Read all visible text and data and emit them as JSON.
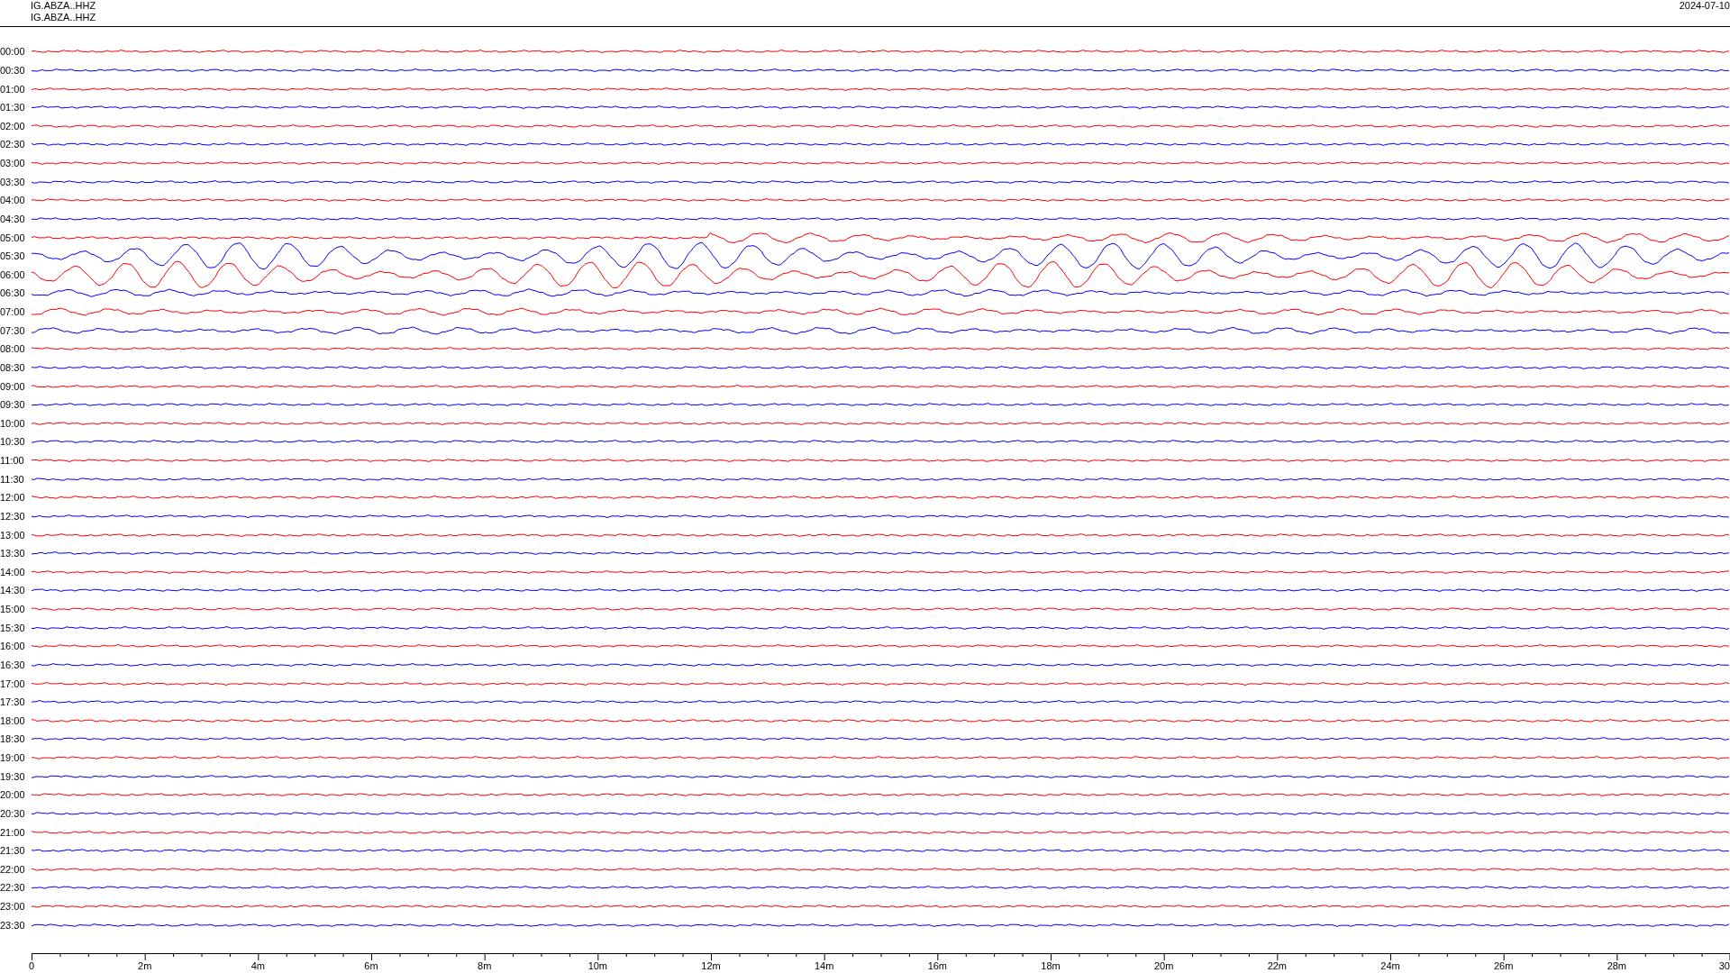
{
  "header": {
    "station_lines": [
      "IG.ABZA..HHZ",
      "IG.ABZA..HHZ"
    ],
    "date": "2024-07-10"
  },
  "traces": [
    {
      "time": "00:00",
      "color": "#ff0000",
      "kind": "noise"
    },
    {
      "time": "00:30",
      "color": "#0000ff",
      "kind": "noise"
    },
    {
      "time": "01:00",
      "color": "#ff0000",
      "kind": "noise"
    },
    {
      "time": "01:30",
      "color": "#0000ff",
      "kind": "noise"
    },
    {
      "time": "02:00",
      "color": "#ff0000",
      "kind": "noise"
    },
    {
      "time": "02:30",
      "color": "#0000ff",
      "kind": "noise"
    },
    {
      "time": "03:00",
      "color": "#ff0000",
      "kind": "noise"
    },
    {
      "time": "03:30",
      "color": "#0000ff",
      "kind": "noise"
    },
    {
      "time": "04:00",
      "color": "#ff0000",
      "kind": "noise"
    },
    {
      "time": "04:30",
      "color": "#0000ff",
      "kind": "noise"
    },
    {
      "time": "05:00",
      "color": "#ff0000",
      "kind": "quake"
    },
    {
      "time": "05:30",
      "color": "#0000ff",
      "kind": "wave"
    },
    {
      "time": "06:00",
      "color": "#ff0000",
      "kind": "wave"
    },
    {
      "time": "06:30",
      "color": "#0000ff",
      "kind": "swell"
    },
    {
      "time": "07:00",
      "color": "#ff0000",
      "kind": "swell"
    },
    {
      "time": "07:30",
      "color": "#0000ff",
      "kind": "swell"
    },
    {
      "time": "08:00",
      "color": "#ff0000",
      "kind": "noise"
    },
    {
      "time": "08:30",
      "color": "#0000ff",
      "kind": "noise"
    },
    {
      "time": "09:00",
      "color": "#ff0000",
      "kind": "noise"
    },
    {
      "time": "09:30",
      "color": "#0000ff",
      "kind": "noise"
    },
    {
      "time": "10:00",
      "color": "#ff0000",
      "kind": "noise"
    },
    {
      "time": "10:30",
      "color": "#0000ff",
      "kind": "noise"
    },
    {
      "time": "11:00",
      "color": "#ff0000",
      "kind": "noise"
    },
    {
      "time": "11:30",
      "color": "#0000ff",
      "kind": "noise"
    },
    {
      "time": "12:00",
      "color": "#ff0000",
      "kind": "noise"
    },
    {
      "time": "12:30",
      "color": "#0000ff",
      "kind": "noise"
    },
    {
      "time": "13:00",
      "color": "#ff0000",
      "kind": "noise"
    },
    {
      "time": "13:30",
      "color": "#0000ff",
      "kind": "noise"
    },
    {
      "time": "14:00",
      "color": "#ff0000",
      "kind": "noise"
    },
    {
      "time": "14:30",
      "color": "#0000ff",
      "kind": "noise"
    },
    {
      "time": "15:00",
      "color": "#ff0000",
      "kind": "noise"
    },
    {
      "time": "15:30",
      "color": "#0000ff",
      "kind": "noise"
    },
    {
      "time": "16:00",
      "color": "#ff0000",
      "kind": "noise"
    },
    {
      "time": "16:30",
      "color": "#0000ff",
      "kind": "noise"
    },
    {
      "time": "17:00",
      "color": "#ff0000",
      "kind": "noise"
    },
    {
      "time": "17:30",
      "color": "#0000ff",
      "kind": "noise"
    },
    {
      "time": "18:00",
      "color": "#ff0000",
      "kind": "noise"
    },
    {
      "time": "18:30",
      "color": "#0000ff",
      "kind": "noise"
    },
    {
      "time": "19:00",
      "color": "#ff0000",
      "kind": "noise"
    },
    {
      "time": "19:30",
      "color": "#0000ff",
      "kind": "noise"
    },
    {
      "time": "20:00",
      "color": "#ff0000",
      "kind": "noise"
    },
    {
      "time": "20:30",
      "color": "#0000ff",
      "kind": "noise"
    },
    {
      "time": "21:00",
      "color": "#ff0000",
      "kind": "noise"
    },
    {
      "time": "21:30",
      "color": "#0000ff",
      "kind": "noise"
    },
    {
      "time": "22:00",
      "color": "#ff0000",
      "kind": "noise"
    },
    {
      "time": "22:30",
      "color": "#0000ff",
      "kind": "noise"
    },
    {
      "time": "23:00",
      "color": "#ff0000",
      "kind": "noise"
    },
    {
      "time": "23:30",
      "color": "#0000ff",
      "kind": "noise"
    }
  ],
  "x_axis": {
    "labels": [
      "0",
      "2m",
      "4m",
      "6m",
      "8m",
      "10m",
      "12m",
      "14m",
      "16m",
      "18m",
      "20m",
      "22m",
      "24m",
      "26m",
      "28m",
      "30"
    ]
  }
}
